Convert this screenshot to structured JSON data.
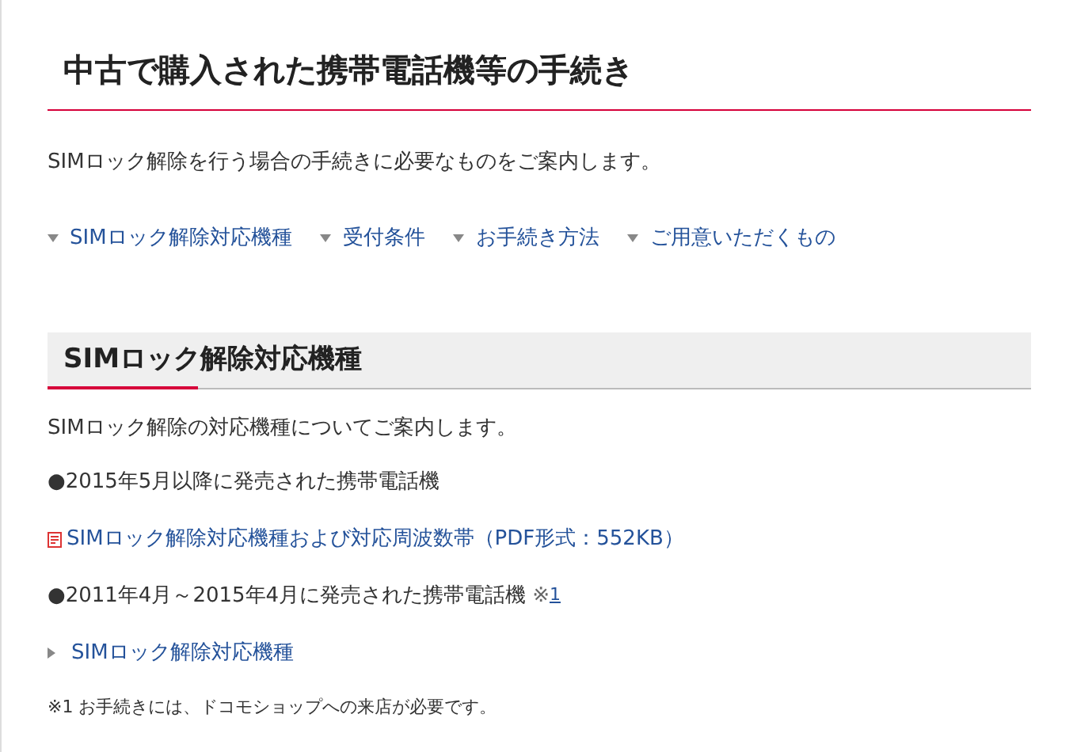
{
  "title": "中古で購入された携帯電話機等の手続き",
  "intro": "SIMロック解除を行う場合の手続きに必要なものをご案内します。",
  "nav_links": [
    "SIMロック解除対応機種",
    "受付条件",
    "お手続き方法",
    "ご用意いただくもの"
  ],
  "section": {
    "heading": "SIMロック解除対応機種",
    "intro": "SIMロック解除の対応機種についてご案内します。",
    "items": [
      {
        "kind": "bullet",
        "marker": "●",
        "text": "2015年5月以降に発売された携帯電話機"
      },
      {
        "kind": "pdf",
        "text": "SIMロック解除対応機種および対応周波数帯（PDF形式：552KB）"
      },
      {
        "kind": "bullet",
        "marker": "●",
        "text": "2011年4月～2015年4月に発売された携帯電話機",
        "note_prefix": "※",
        "note_link": "1"
      },
      {
        "kind": "arrow",
        "text": "SIMロック解除対応機種"
      }
    ],
    "footnote": "※1 お手続きには、ドコモショップへの来店が必要です。"
  }
}
